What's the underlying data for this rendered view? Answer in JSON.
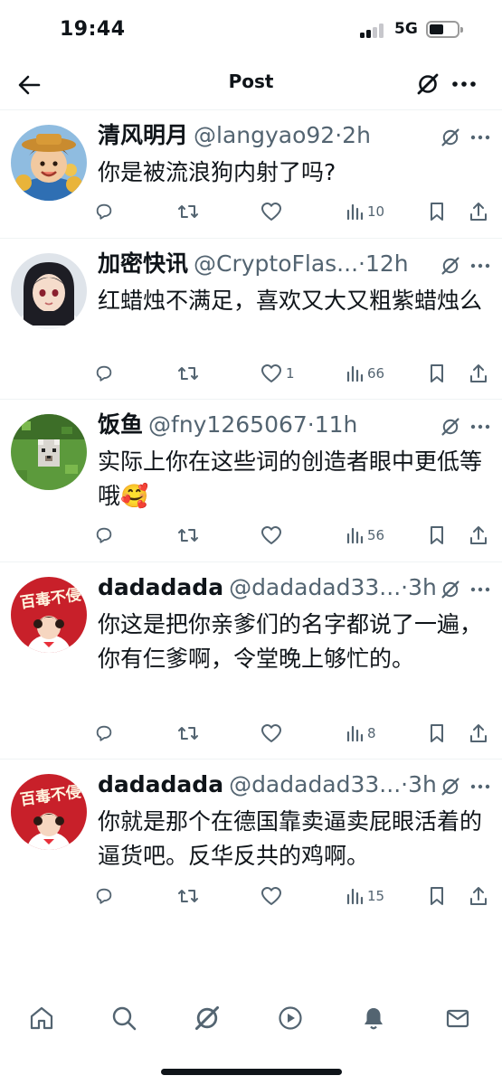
{
  "status_bar": {
    "time": "19:44",
    "network": "5G"
  },
  "header": {
    "title": "Post"
  },
  "replies": [
    {
      "name": "清风明月",
      "handle": "@langyao92",
      "time": "2h",
      "text": "你是被流浪狗内射了吗?",
      "likes": "",
      "views": "10"
    },
    {
      "name": "加密快讯",
      "handle": "@CryptoFlas...",
      "time": "12h",
      "text": "红蜡烛不满足，喜欢又大又粗紫蜡烛么",
      "likes": "1",
      "views": "66"
    },
    {
      "name": "饭鱼",
      "handle": "@fny1265067",
      "time": "11h",
      "text": "实际上你在这些词的创造者眼中更低等哦🥰",
      "likes": "",
      "views": "56"
    },
    {
      "name": "dadadada",
      "handle": "@dadadad33...",
      "time": "3h",
      "text": "你这是把你亲爹们的名字都说了一遍，你有仨爹啊，令堂晚上够忙的。",
      "likes": "",
      "views": "8"
    },
    {
      "name": "dadadada",
      "handle": "@dadadad33...",
      "time": "3h",
      "text": "你就是那个在德国靠卖逼卖屁眼活着的逼货吧。反华反共的鸡啊。",
      "likes": "",
      "views": "15"
    }
  ],
  "icons": {
    "back": "arrow-left-icon",
    "grok": "grok-icon",
    "more": "more-icon",
    "reply": "reply-icon",
    "retweet": "retweet-icon",
    "like": "heart-icon",
    "views": "views-icon",
    "bookmark": "bookmark-icon",
    "share": "share-icon",
    "nav": [
      "home-icon",
      "search-icon",
      "grok-icon",
      "video-icon",
      "notifications-icon",
      "messages-icon"
    ]
  },
  "colors": {
    "text": "#0f1419",
    "secondary": "#536471",
    "divider": "#eff3f4"
  }
}
